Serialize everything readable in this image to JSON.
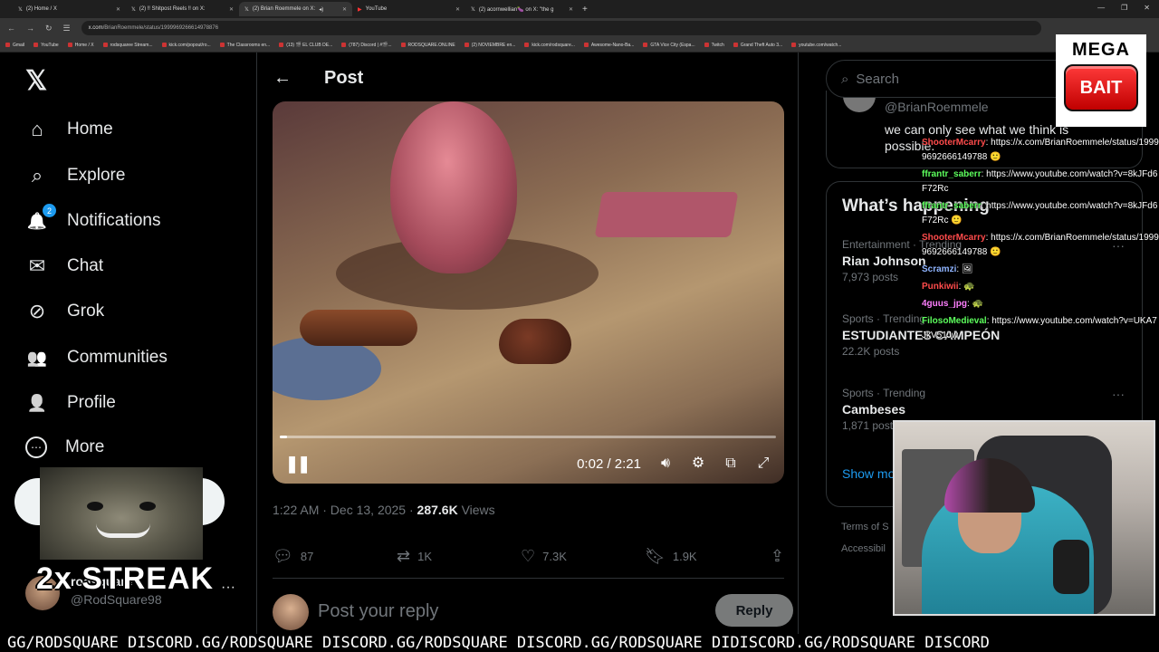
{
  "browser": {
    "tabs": [
      {
        "label": "(2) Home / X"
      },
      {
        "label": "(2) ‼ Shitpost Reels ‼ on X:"
      },
      {
        "label": "(2) Brian Roemmele on X:"
      },
      {
        "label": "YouTube"
      },
      {
        "label": "(2) acornwellian🍆 on X: \"the g"
      }
    ],
    "url_host": "x.com",
    "url_path": "/BrianRoemmele/status/1999969266614978876",
    "bookmarks": [
      "Gmail",
      "YouTube",
      "Home / X",
      "rodsquaree Stream...",
      "kick.com/popout/ro...",
      "The Classrooms en...",
      "(13) 🎬 EL CLUB DE...",
      "(787) Discord | #🎬...",
      "RODSQUARE.ONLINE",
      "(2) NOVIEMBRE en...",
      "kick.com/rodsquare...",
      "Awesome-Nano-Ba...",
      "GTA Vice City (Espa...",
      "Twitch",
      "Grand Theft Auto 3...",
      "youtube.com/watch..."
    ]
  },
  "nav": {
    "items": [
      {
        "label": "Home",
        "icon": "⌂"
      },
      {
        "label": "Explore",
        "icon": "⌕"
      },
      {
        "label": "Notifications",
        "icon": "🔔",
        "badge": "2"
      },
      {
        "label": "Chat",
        "icon": "✉"
      },
      {
        "label": "Grok",
        "icon": "⊘"
      },
      {
        "label": "Communities",
        "icon": "👥"
      },
      {
        "label": "Profile",
        "icon": "👤"
      },
      {
        "label": "More",
        "icon": "⋯"
      }
    ],
    "user_name": "rodsquare",
    "user_handle": "@RodSquare98",
    "streak_text": "2x STREAK"
  },
  "post": {
    "header_title": "Post",
    "video_time": "0:02 / 2:21",
    "video_progress": 0.015,
    "timestamp": "1:22 AM · Dec 13, 2025 · ",
    "views_count": "287.6K",
    "views_label": " Views",
    "replies": "87",
    "reposts": "1K",
    "likes": "7.3K",
    "bookmarks": "1.9K",
    "reply_placeholder": "Post your reply",
    "reply_button": "Reply"
  },
  "sidebar": {
    "search_placeholder": "Search",
    "author_handle": "@BrianRoemmele",
    "author_text": "we can only see what we think is possible.",
    "trends_title": "What’s happening",
    "trends": [
      {
        "category": "Entertainment · Trending",
        "name": "Rian Johnson",
        "posts": "7,973 posts"
      },
      {
        "category": "Sports · Trending",
        "name": "ESTUDIANTES CAMPEÓN",
        "posts": "22.2K posts"
      },
      {
        "category": "Sports · Trending",
        "name": "Cambeses",
        "posts": "1,871 posts"
      }
    ],
    "show_more": "Show more",
    "footer_1": "Terms of S",
    "footer_2": "Accessibil"
  },
  "chat_overlay": [
    {
      "user": "ShooterMcarry",
      "text": "https://x.com/BrianRoemmele/status/19999692666149788 🙂"
    },
    {
      "user": "ffrantr_saberr",
      "text": "https://www.youtube.com/watch?v=8kJFd6F72Rc"
    },
    {
      "user": "ffrantr_saberr",
      "text": "https://www.youtube.com/watch?v=8kJFd6F72Rc 🙂"
    },
    {
      "user": "ShooterMcarry",
      "text": "https://x.com/BrianRoemmele/status/19999692666149788 🙂"
    },
    {
      "user": "Scramzi",
      "text": "🖼"
    },
    {
      "user": "Punkiwii",
      "text": "🐢"
    },
    {
      "user": "4guus_jpg",
      "text": "🐢"
    },
    {
      "user": "FilosoMedieval",
      "text": "https://www.youtube.com/watch?v=UKA7JkV51Jw"
    }
  ],
  "mega_bait": {
    "top": "MEGA",
    "button": "BAIT"
  },
  "ticker": "GG/RODSQUARE DISCORD.GG/RODSQUARE DISCORD.GG/RODSQUARE DISCORD.GG/RODSQUARE DIDISCORD.GG/RODSQUARE DISCORD"
}
